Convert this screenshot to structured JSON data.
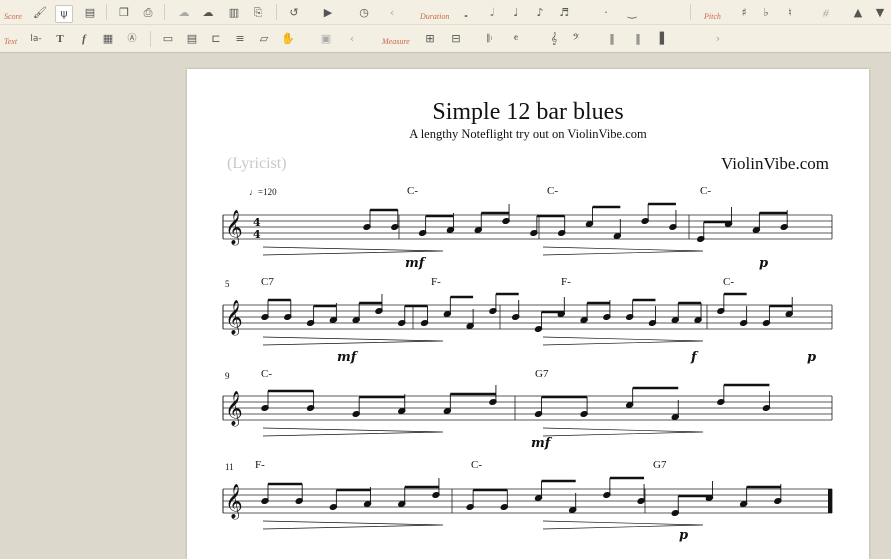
{
  "toolbar": {
    "row1_label": "Score",
    "row2_label": "Text",
    "duration_label": "Duration",
    "pitch_label": "Pitch",
    "measure_label": "Measure",
    "text_tool_1": "la-",
    "text_tool_2": "T",
    "text_tool_3": "f",
    "left_arrow": "‹",
    "right_arrow": "›"
  },
  "score": {
    "title": "Simple 12 bar blues",
    "subtitle": "A lengthy Noteflight try out on ViolinVibe.com",
    "lyricist": "(Lyricist)",
    "composer": "ViolinVibe.com",
    "tempo": "♩=120",
    "systems": [
      {
        "measure_number": "",
        "chords": [
          "C-",
          "C-",
          "C-"
        ],
        "dynamics": [
          "mf",
          "p"
        ]
      },
      {
        "measure_number": "5",
        "chords": [
          "C7",
          "F-",
          "F-",
          "C-"
        ],
        "dynamics": [
          "mf",
          "f",
          "p"
        ]
      },
      {
        "measure_number": "9",
        "chords": [
          "C-",
          "G7"
        ],
        "dynamics": [
          "mf"
        ]
      },
      {
        "measure_number": "11",
        "chords": [
          "F-",
          "C-",
          "G7"
        ],
        "dynamics": [
          "p"
        ]
      }
    ]
  }
}
